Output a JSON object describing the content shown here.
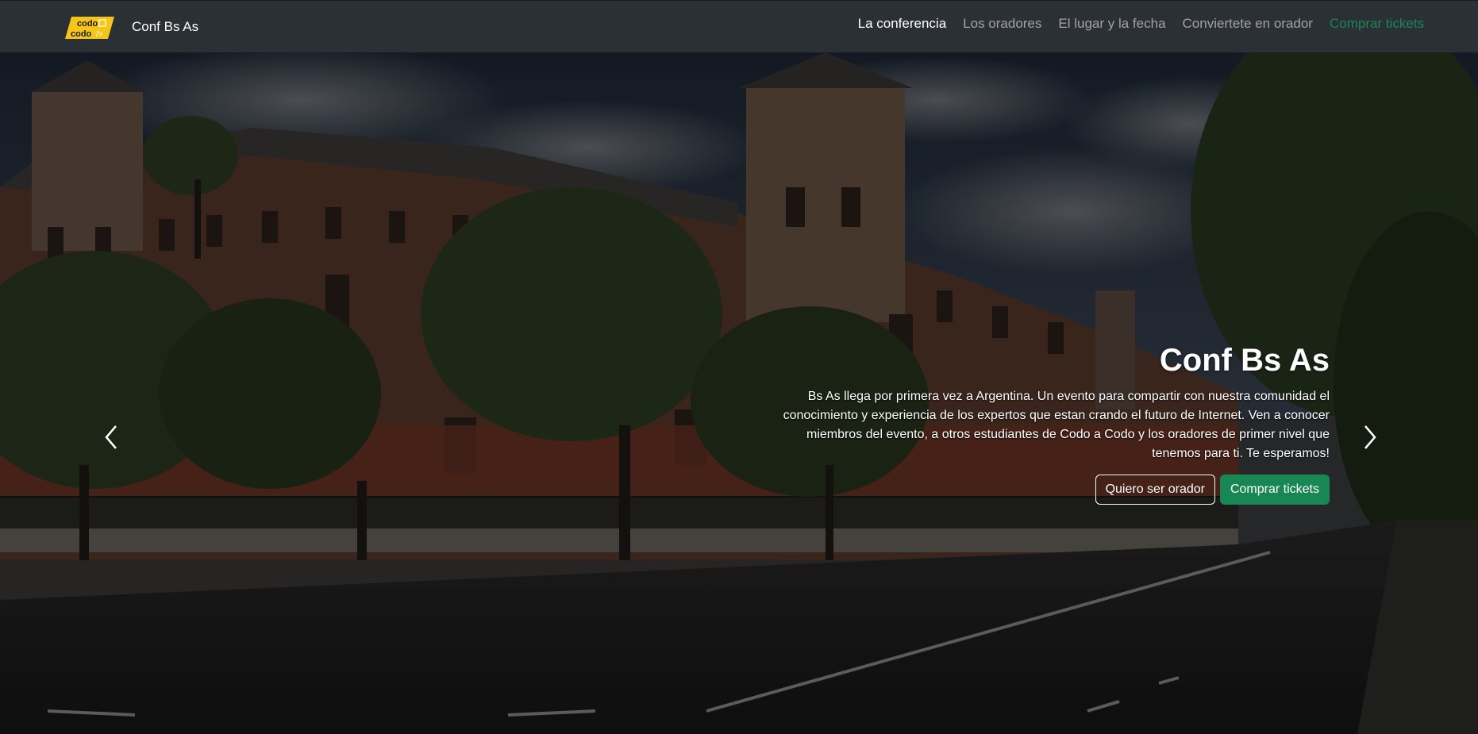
{
  "navbar": {
    "logo_text_top": "codo",
    "logo_text_bottom": "codo",
    "brand": "Conf Bs As",
    "links": [
      {
        "label": "La conferencia",
        "state": "active"
      },
      {
        "label": "Los oradores",
        "state": "normal"
      },
      {
        "label": "El lugar y la fecha",
        "state": "normal"
      },
      {
        "label": "Conviertete en orador",
        "state": "normal"
      },
      {
        "label": "Comprar tickets",
        "state": "green"
      }
    ]
  },
  "hero": {
    "title": "Conf Bs As",
    "description": "Bs As llega por primera vez a Argentina. Un evento para compartir con nuestra comunidad el conocimiento y experiencia de los expertos que estan crando el futuro de Internet. Ven a conocer miembros del evento, a otros estudiantes de Codo a Codo y los oradores de primer nivel que tenemos para ti. Te esperamos!",
    "button_speaker": "Quiero ser orador",
    "button_tickets": "Comprar tickets"
  },
  "colors": {
    "navbar_bg": "#2b3035",
    "success": "#198754",
    "logo_yellow": "#f5c518"
  },
  "icons": {
    "prev": "chevron-left-icon",
    "next": "chevron-right-icon"
  }
}
